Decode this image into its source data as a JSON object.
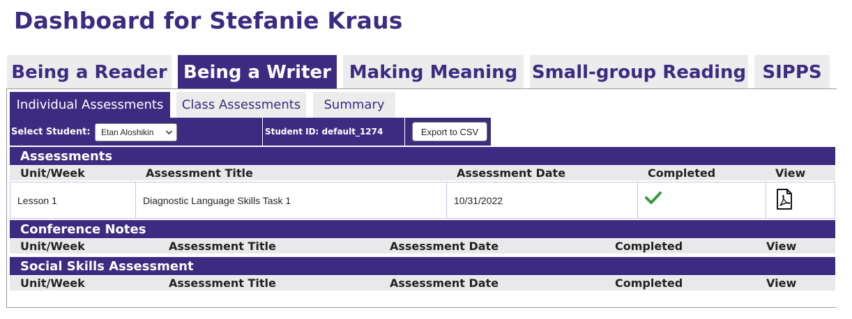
{
  "page_title": "Dashboard for Stefanie Kraus",
  "top_tabs": [
    {
      "label": "Being a Reader",
      "active": false
    },
    {
      "label": "Being a Writer",
      "active": true
    },
    {
      "label": "Making Meaning",
      "active": false
    },
    {
      "label": "Small-group Reading",
      "active": false
    },
    {
      "label": "SIPPS",
      "active": false
    }
  ],
  "sub_tabs": [
    {
      "label": "Individual Assessments",
      "active": true
    },
    {
      "label": "Class Assessments",
      "active": false
    },
    {
      "label": "Summary",
      "active": false
    }
  ],
  "toolbar": {
    "select_label": "Select Student:",
    "selected_student": "Etan Aloshikin",
    "student_id": "Student ID:  default_1274",
    "export_label": "Export to CSV"
  },
  "sections": {
    "assessments": {
      "title": "Assessments",
      "columns": [
        "Unit/Week",
        "Assessment Title",
        "Assessment Date",
        "Completed",
        "View"
      ],
      "rows": [
        {
          "unit": "Lesson 1",
          "title": "Diagnostic Language Skills Task 1",
          "date": "10/31/2022",
          "completed_icon": "checkmark-icon",
          "view_icon": "pdf-icon"
        }
      ]
    },
    "conference_notes": {
      "title": "Conference Notes",
      "columns": [
        "Unit/Week",
        "Assessment Title",
        "Assessment Date",
        "Completed",
        "View"
      ]
    },
    "social_skills": {
      "title": "Social Skills Assessment",
      "columns": [
        "Unit/Week",
        "Assessment Title",
        "Assessment Date",
        "Completed",
        "View"
      ]
    }
  },
  "colors": {
    "brand": "#3d2b82",
    "tab_inactive": "#ececec",
    "check_green": "#3a9a3e"
  }
}
